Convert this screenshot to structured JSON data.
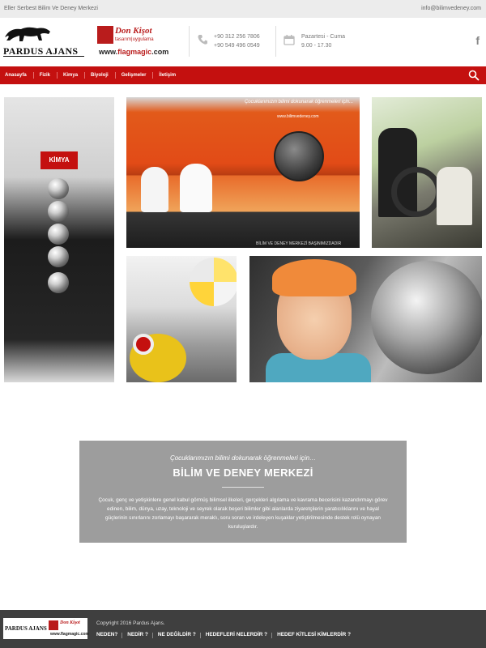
{
  "topbar": {
    "tagline": "Eller Serbest Bilim Ve Deney Merkezi",
    "email": "info@bilimvedeney.com"
  },
  "header": {
    "pardus_logo_text": "PARDUS AJANS",
    "donkisot_name": "Don Kişot",
    "donkisot_sub": "tasarım|uygulama",
    "donkisot_url_a": "www.",
    "donkisot_url_b": "flagmagic",
    "donkisot_url_c": ".com",
    "phone_1": "+90 312 256 7806",
    "phone_2": "+90 549 496 0549",
    "days": "Pazartesi - Cuma",
    "hours": "9.00 - 17.30",
    "facebook_glyph": "f"
  },
  "nav": {
    "items": [
      "Anasayfa",
      "Fizik",
      "Kimya",
      "Biyoloji",
      "Gelişmeler",
      "İletişim"
    ]
  },
  "gallery": {
    "kimya_badge": "KİMYA",
    "poster_caption": "Çocuklarımızın bilimi dokunarak öğrenmeleri için...",
    "poster_site": "www.bilimvedeney.com",
    "poster_footer": "BİLİM VE DENEY MERKEZİ BAŞINIMIZDADIR"
  },
  "promo": {
    "lead": "Çocuklarımızın bilimi dokunarak öğrenmeleri için…",
    "title": "BİLİM VE DENEY MERKEZİ",
    "body": "Çocuk, genç ve yetişkinlere genel kabul görmüş bilimsel ilkeleri, gerçekleri algılama ve kavrama becerisini kazandırmayı görev edinen, bilim, dünya, uzay, teknoloji ve seyrek olarak beşeri bilimler gibi alanlarda ziyaretçilerin yaratıcılıklarını ve hayal güçlerinin sınırlarını zorlamayı başararak meraklı, soru soran ve irdeleyen kuşaklar yetiştirilmesinde destek rolü oynayan kuruluşlardır."
  },
  "footer": {
    "logo_pardus": "PARDUS AJANS",
    "logo_donkisot": "Don Kişot",
    "logo_url": "www.flagmagic.com",
    "copyright": "Copyright 2016 Pardus Ajans.",
    "links": [
      "NEDEN?",
      "NEDİR ?",
      "NE DEĞİLDİR ?",
      "HEDEFLERİ NELERDİR ?",
      "HEDEF KİTLESİ KİMLERDİR ?"
    ]
  },
  "colors": {
    "nav_red": "#c4100f",
    "promo_gray": "#9d9d9d",
    "footer_dark": "#3f3f3f"
  }
}
